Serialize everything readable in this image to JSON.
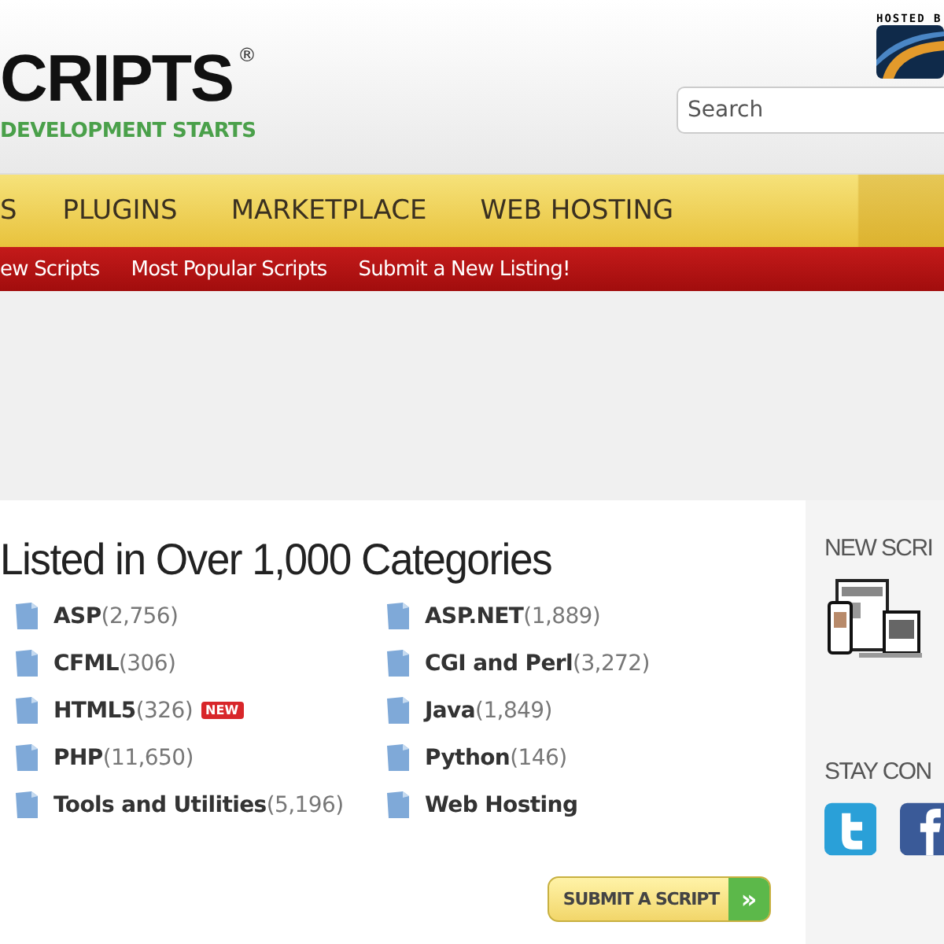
{
  "header": {
    "logo": "CRIPTS",
    "registered": "®",
    "tagline": "DEVELOPMENT STARTS",
    "hosted_by": "HOSTED B",
    "search": {
      "placeholder": "Search"
    }
  },
  "nav": [
    {
      "label": "S"
    },
    {
      "label": "PLUGINS"
    },
    {
      "label": "MARKETPLACE"
    },
    {
      "label": "WEB HOSTING"
    }
  ],
  "subnav": [
    {
      "label": "ew Scripts"
    },
    {
      "label": "Most Popular Scripts"
    },
    {
      "label": "Submit a New Listing!"
    }
  ],
  "main": {
    "heading": "Listed in Over 1,000 Categories",
    "categories": [
      {
        "name": "ASP",
        "count": "(2,756)"
      },
      {
        "name": "ASP.NET",
        "count": "(1,889)"
      },
      {
        "name": "CFML",
        "count": "(306)"
      },
      {
        "name": "CGI and Perl",
        "count": "(3,272)"
      },
      {
        "name": "HTML5",
        "count": "(326)",
        "badge": "NEW"
      },
      {
        "name": "Java",
        "count": "(1,849)"
      },
      {
        "name": "PHP",
        "count": "(11,650)"
      },
      {
        "name": "Python",
        "count": "(146)"
      },
      {
        "name": "Tools and Utilities",
        "count": "(5,196)"
      },
      {
        "name": "Web Hosting"
      }
    ],
    "submit_button": "SUBMIT A SCRIPT",
    "submit_arrow": "»"
  },
  "sidebar": {
    "new_heading": "NEW SCRI",
    "connect_heading": "STAY CON"
  }
}
